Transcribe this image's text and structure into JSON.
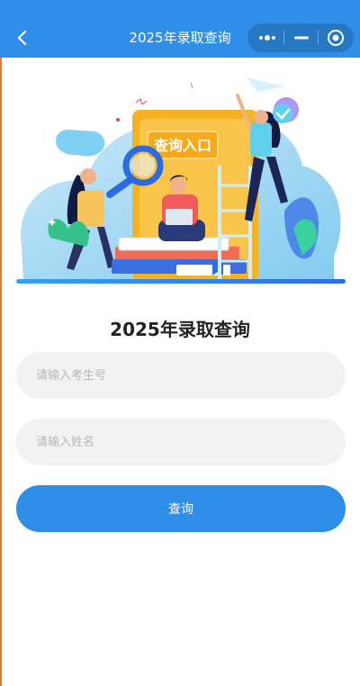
{
  "navbar": {
    "title": "2025年录取查询",
    "back_icon": "chevron-left-icon",
    "capsule": {
      "more_icon": "more-dots-icon",
      "minimize_icon": "minimize-icon",
      "close_icon": "target-circle-icon"
    }
  },
  "banner": {
    "sign_text": "查询入口"
  },
  "page": {
    "title": "2025年录取查询"
  },
  "form": {
    "exam_number": {
      "placeholder": "请输入考生号",
      "value": ""
    },
    "name": {
      "placeholder": "请输入姓名",
      "value": ""
    },
    "submit_label": "查询"
  },
  "colors": {
    "primary": "#2f8fe8",
    "field_bg": "#f2f2f2",
    "placeholder": "#b7b7b7",
    "title": "#222222"
  }
}
